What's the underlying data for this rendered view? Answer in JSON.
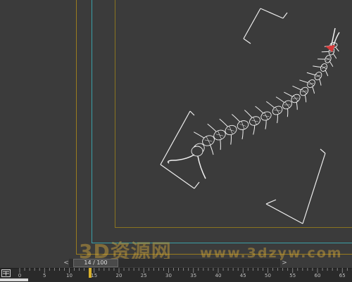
{
  "viewport": {
    "background": "#3b3b3b",
    "wireframe_color": "#f2f2f2",
    "safe_frame_color": "#9a7b1f",
    "region_color": "#3aa0a8",
    "model": "centipede-wireframe"
  },
  "watermark": {
    "cn": "3D资源网",
    "url": "www.3dzyw.com",
    "color": "#e2b23c"
  },
  "time_slider": {
    "readout": "14 / 100",
    "current_frame": 14,
    "total_frames": 100,
    "left_arrow_icon": "arrow-left-icon",
    "right_arrow_icon": "arrow-right-icon"
  },
  "trackbar": {
    "icon": "curve-editor-icon",
    "ticks": [
      "0",
      "5",
      "10",
      "15",
      "20",
      "25",
      "30",
      "35",
      "40",
      "45",
      "50",
      "55",
      "60",
      "65"
    ],
    "marker_color": "#d8b02a"
  }
}
